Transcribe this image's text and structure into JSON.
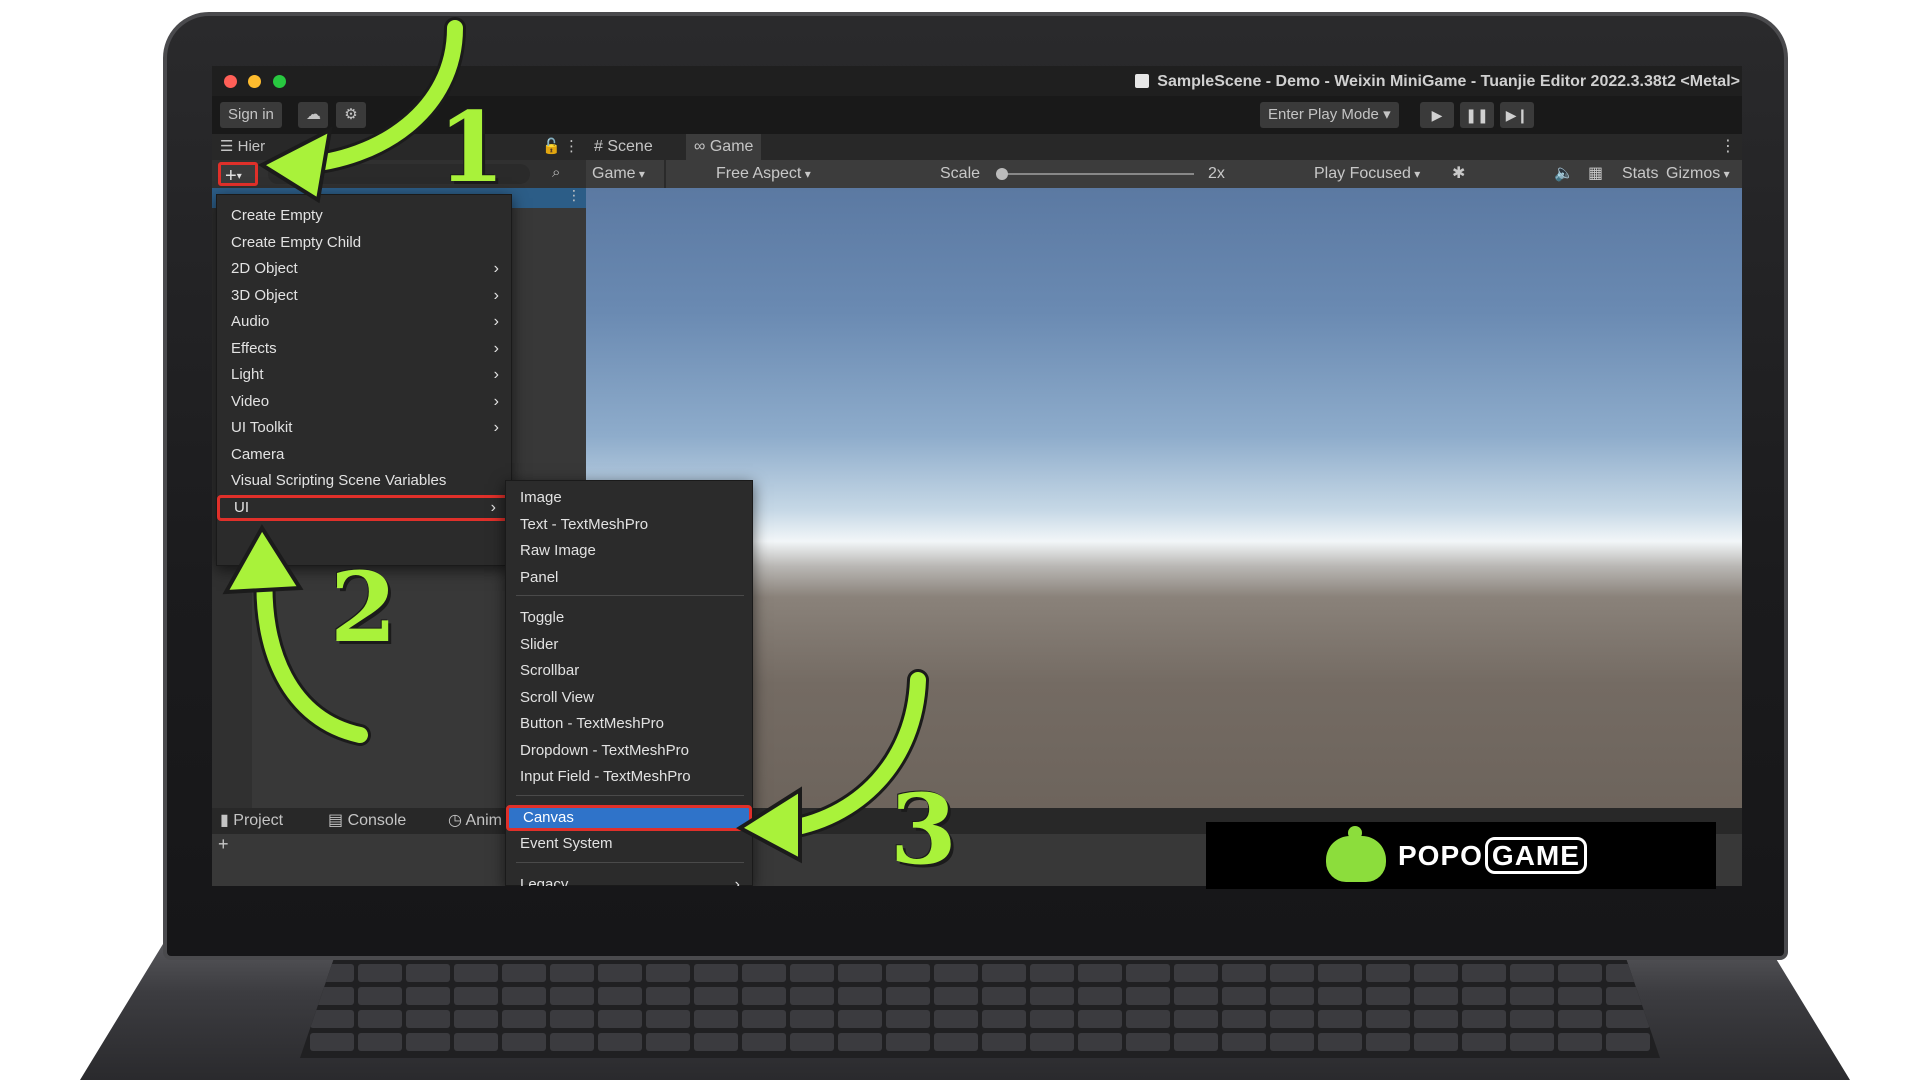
{
  "window": {
    "title": "SampleScene - Demo - Weixin MiniGame - Tuanjie Editor 2022.3.38t2 <Metal>"
  },
  "toolbar": {
    "sign_in": "Sign in",
    "play_mode": "Enter Play Mode",
    "play_mode_arrow": "▾",
    "cloud_icon": "☁",
    "gear_icon": "⚙",
    "play_icon": "▶",
    "pause_icon": "❚❚",
    "step_icon": "▶❙"
  },
  "hierarchy": {
    "tab_label": "Hier",
    "add_button": "+",
    "add_button_arrow": "▾",
    "lock_icon": "🔓",
    "kebab": "⋮",
    "find_icon": "⌕"
  },
  "view_tabs": {
    "scene": "Scene",
    "game": "Game",
    "scene_icon": "#",
    "game_icon": "∞"
  },
  "game_toolbar": {
    "display": "Game",
    "aspect": "Free Aspect",
    "scale_label": "Scale",
    "scale_value": "2x",
    "play_focused": "Play Focused",
    "bug_icon": "✱",
    "audio_icon": "🔈",
    "grid_icon": "▦",
    "stats": "Stats",
    "gizmos": "Gizmos"
  },
  "bottom_tabs": {
    "project": "Project",
    "console": "Console",
    "anim": "Anim",
    "project_icon": "▮",
    "console_icon": "▤",
    "anim_icon": "◷",
    "plus": "+"
  },
  "context_menu": {
    "items": [
      {
        "label": "Create Empty",
        "submenu": false
      },
      {
        "label": "Create Empty Child",
        "submenu": false
      },
      {
        "label": "2D Object",
        "submenu": true
      },
      {
        "label": "3D Object",
        "submenu": true
      },
      {
        "label": "Audio",
        "submenu": true
      },
      {
        "label": "Effects",
        "submenu": true
      },
      {
        "label": "Light",
        "submenu": true
      },
      {
        "label": "Video",
        "submenu": true
      },
      {
        "label": "UI Toolkit",
        "submenu": true
      },
      {
        "label": "Camera",
        "submenu": false
      },
      {
        "label": "Visual Scripting Scene Variables",
        "submenu": false
      },
      {
        "label": "UI",
        "submenu": true
      }
    ],
    "arrow": "›"
  },
  "ui_submenu": {
    "group1": [
      "Image",
      "Text - TextMeshPro",
      "Raw Image",
      "Panel"
    ],
    "group2": [
      "Toggle",
      "Slider",
      "Scrollbar",
      "Scroll View",
      "Button - TextMeshPro",
      "Dropdown - TextMeshPro",
      "Input Field - TextMeshPro"
    ],
    "group3": [
      "Canvas",
      "Event System"
    ],
    "group4": [
      "Legacy"
    ],
    "selected": "Canvas"
  },
  "annotations": {
    "step1": "1",
    "step2": "2",
    "step3": "3",
    "arrow_color": "#a9f23a",
    "highlight_color": "#e0302a"
  },
  "logo": {
    "text_a": "POPO",
    "text_b": "GAME",
    "icon": "popogame-mascot-icon"
  },
  "colors": {
    "selection": "#2f73c9",
    "panel": "#383838",
    "titlebar": "#1f1f1f"
  }
}
